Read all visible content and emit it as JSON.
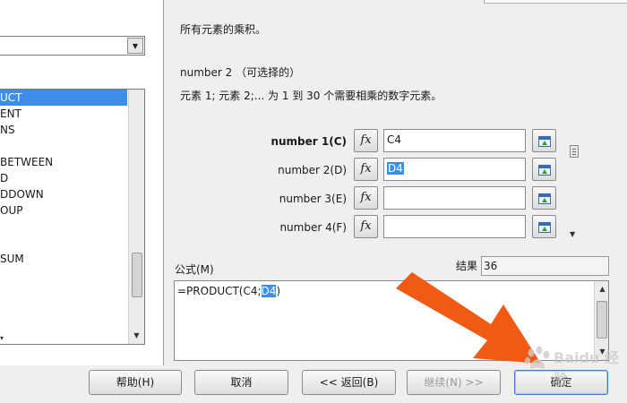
{
  "left": {
    "category_value": "",
    "functions": [
      {
        "label": "UCT",
        "selected": true
      },
      {
        "label": "ENT",
        "selected": false
      },
      {
        "label": "NS",
        "selected": false
      },
      {
        "label": "",
        "selected": false
      },
      {
        "label": "BETWEEN",
        "selected": false
      },
      {
        "label": "D",
        "selected": false
      },
      {
        "label": "DDOWN",
        "selected": false
      },
      {
        "label": "OUP",
        "selected": false
      },
      {
        "label": "",
        "selected": false
      },
      {
        "label": "",
        "selected": false
      },
      {
        "label": "SUM",
        "selected": false
      }
    ]
  },
  "function_description": "所有元素的乘积。",
  "argument": {
    "title": "number 2 （可选择的）",
    "description": "元素 1; 元素  2;...  为 1 到 30 个需要相乘的数字元素。"
  },
  "arguments": [
    {
      "label": "number 1(C)",
      "value": "C4",
      "highlight": false,
      "bold": true
    },
    {
      "label": "number 2(D)",
      "value": "D4",
      "highlight": true,
      "bold": false
    },
    {
      "label": "number 3(E)",
      "value": "",
      "highlight": false,
      "bold": false
    },
    {
      "label": "number 4(F)",
      "value": "",
      "highlight": false,
      "bold": false
    }
  ],
  "fx_label": "fx",
  "formula": {
    "label": "公式(M)",
    "prefix": "=PRODUCT(C4;",
    "highlight": "D4",
    "suffix": ")"
  },
  "result": {
    "label": "结果",
    "value": "36"
  },
  "buttons": {
    "help": "帮助(H)",
    "cancel": "取消",
    "back": "<< 返回(B)",
    "next": "继续(N) >>",
    "ok": "确定"
  },
  "watermark": "Baidu 经验",
  "colors": {
    "selection": "#3d8ee6",
    "arrow": "#f05a14"
  }
}
